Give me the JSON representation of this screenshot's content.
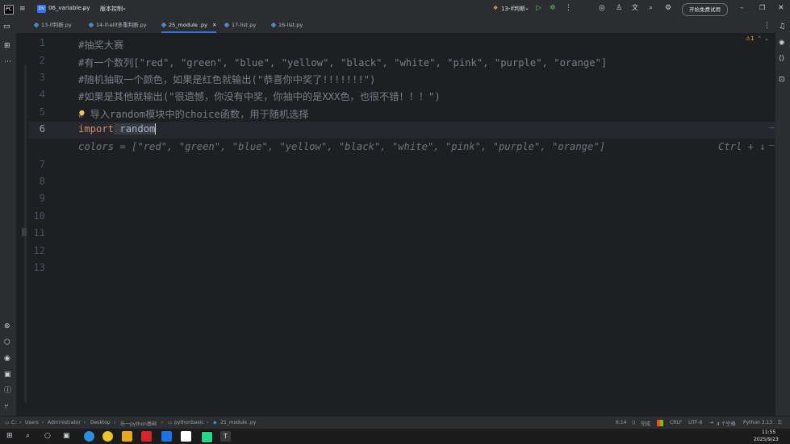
{
  "titlebar": {
    "project_badge": "DV",
    "project_name": "06_variable.py",
    "vcs": "版本控制",
    "run_config": "13-if判断",
    "trial_button": "开始免费试用"
  },
  "tabs": [
    {
      "label": "13-if判断.py"
    },
    {
      "label": "14-if-elif多重判断.py"
    },
    {
      "label": "25_module .py"
    },
    {
      "label": "17-list.py"
    },
    {
      "label": "16-list.py"
    }
  ],
  "editor": {
    "warnings": "1",
    "current_line": "6",
    "lines": [
      {
        "num": "1",
        "text": "#抽奖大赛"
      },
      {
        "num": "2",
        "text": "#有一个数列[\"red\", \"green\", \"blue\", \"yellow\", \"black\", \"white\", \"pink\", \"purple\", \"orange\"]"
      },
      {
        "num": "3",
        "text": "#随机抽取一个颜色，如果是红色就输出(\"恭喜你中奖了!!!!!!!\")"
      },
      {
        "num": "4",
        "text": "#如果是其他就输出(\"很遗憾，你没有中奖，你抽中的是XXX色，也很不错！！！\")"
      },
      {
        "num": "5",
        "text": "# 导入random模块中的choice函数，用于随机选择"
      },
      {
        "num": "6",
        "kw": "import",
        "text": " random"
      },
      {
        "num": "7"
      },
      {
        "num": "8"
      },
      {
        "num": "9"
      },
      {
        "num": "10"
      },
      {
        "num": "11"
      },
      {
        "num": "12"
      },
      {
        "num": "13"
      }
    ],
    "inline_completion": "colors = [\"red\", \"green\", \"blue\", \"yellow\", \"black\", \"white\", \"pink\", \"purple\", \"orange\"]",
    "completion_shortcut": "Ctrl + ↓"
  },
  "statusbar": {
    "breadcrumb": [
      "C:",
      "Users",
      "Administrator",
      "Desktop",
      "乐一python基础",
      "pythonbasic",
      "25_module .py"
    ],
    "position": "6:14",
    "ai_status": "完成",
    "line_sep": "CRLF",
    "encoding": "UTF-8",
    "indent": "4 个空格",
    "interpreter": "Python 3.13"
  },
  "taskbar": {
    "time": "11:55",
    "date": "2025/9/23"
  },
  "colors": {
    "background": "#1e1f22",
    "chrome": "#2b2d30",
    "accent": "#3574f0",
    "comment": "#7a7e85",
    "keyword": "#cf8e6d"
  }
}
